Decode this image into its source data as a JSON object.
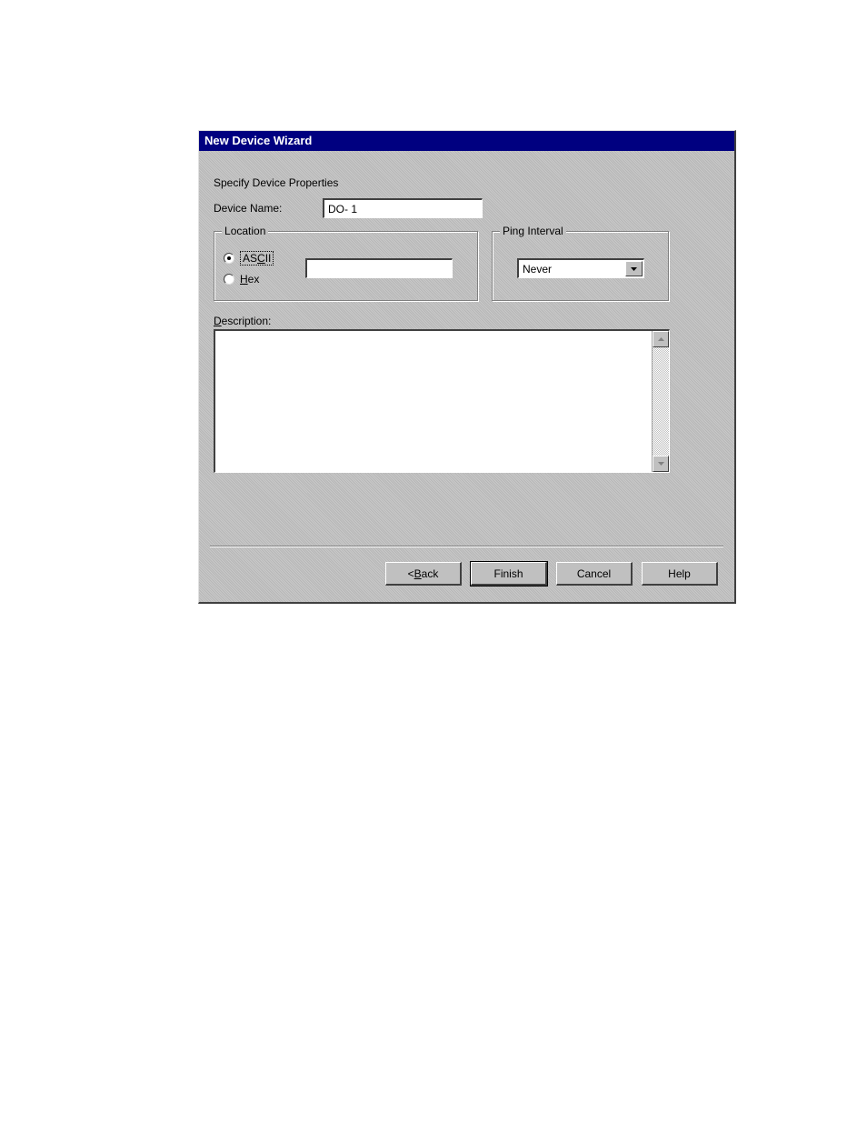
{
  "window": {
    "title": "New Device Wizard",
    "subtitle": "Specify Device Properties"
  },
  "fields": {
    "device_name_label": "Device Name:",
    "device_name_value": "DO- 1"
  },
  "location": {
    "legend_pre": "L",
    "legend_post": "ocation",
    "ascii_pre": "AS",
    "ascii_ul": "C",
    "ascii_post": "II",
    "hex_ul": "H",
    "hex_post": "ex",
    "selected": "ascii",
    "value": ""
  },
  "ping": {
    "legend_ul": "P",
    "legend_post": "ing Interval",
    "selected": "Never"
  },
  "description": {
    "label_ul": "D",
    "label_post": "escription:",
    "value": ""
  },
  "buttons": {
    "back_pre": "< ",
    "back_ul": "B",
    "back_post": "ack",
    "finish": "Finish",
    "cancel": "Cancel",
    "help": "Help"
  }
}
